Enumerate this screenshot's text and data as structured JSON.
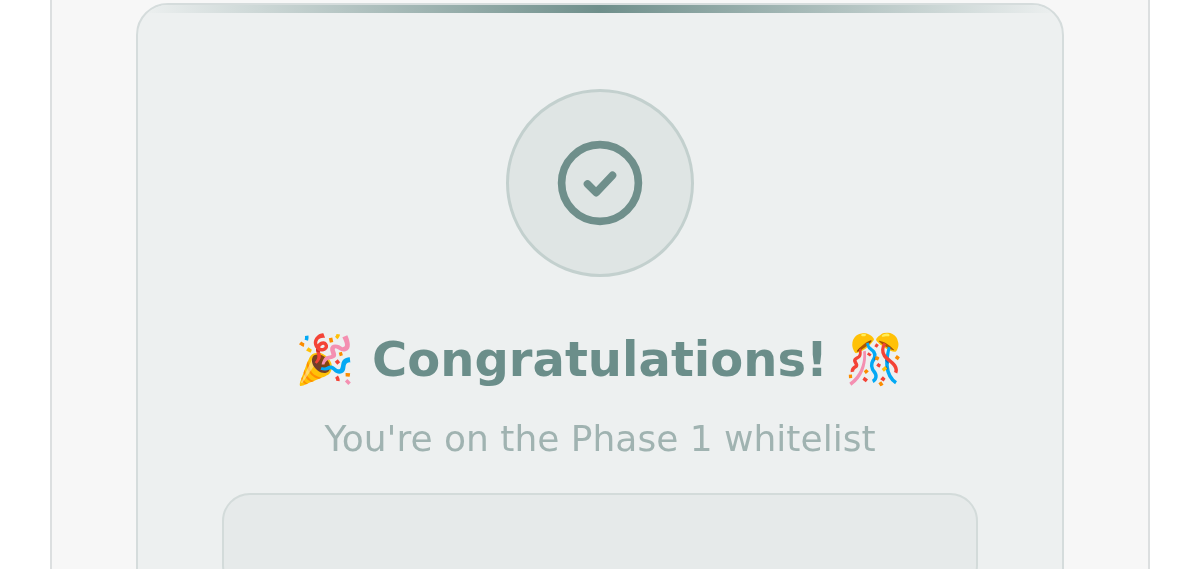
{
  "card": {
    "title": "🎉 Congratulations! 🎊",
    "subtitle": "You're on the Phase 1 whitelist"
  }
}
